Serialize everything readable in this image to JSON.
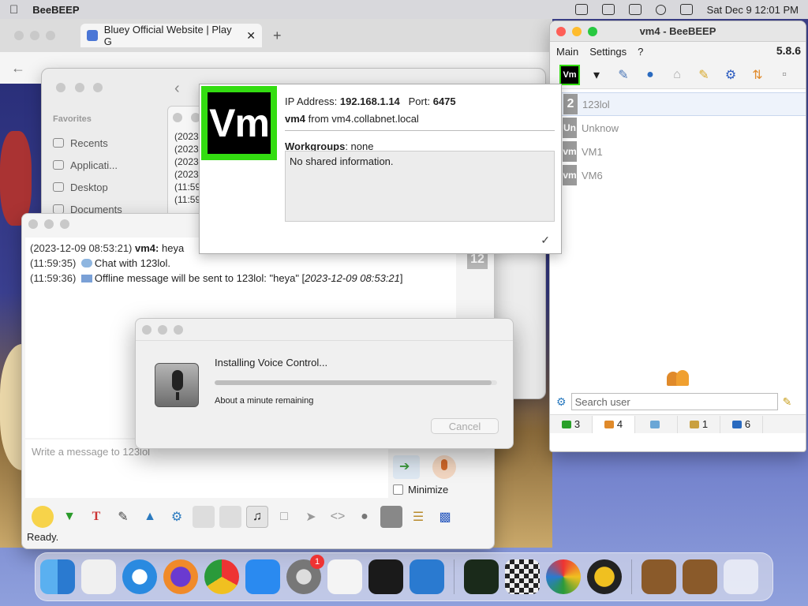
{
  "menubar": {
    "app_name": "BeeBEEP",
    "datetime": "Sat Dec 9  12:01 PM"
  },
  "browser": {
    "tab_title": "Bluey Official Website | Play G",
    "close_symbol": "✕",
    "new_tab_symbol": "+"
  },
  "finder": {
    "section_favorites": "Favorites",
    "items": [
      "Recents",
      "Applicati...",
      "Desktop",
      "Documents"
    ]
  },
  "logwin": {
    "lines": [
      "(2023",
      "(2023",
      "(2023",
      "(2023",
      "(11:59",
      "(11:59"
    ]
  },
  "chat": {
    "title": "123lol",
    "side_number": "12",
    "messages": [
      {
        "ts": "(2023-12-09 08:53:21)",
        "user": "vm4:",
        "text": "heya"
      },
      {
        "ts": "(11:59:35)",
        "text": "Chat with 123lol."
      },
      {
        "ts": "(11:59:36)",
        "text": "Offline message will be sent to 123lol: \"heya\" [",
        "italic": "2023-12-09 08:53:21",
        "end": "]"
      }
    ],
    "input_placeholder": "Write a message to 123lol",
    "minimize_label": "Minimize",
    "status": "Ready."
  },
  "popup": {
    "avatar_text": "Vm",
    "ip_label": "IP Address:",
    "ip_value": "192.168.1.14",
    "port_label": "Port:",
    "port_value": "6475",
    "user": "vm4",
    "from_text": "from vm4.collabnet.local",
    "workgroups_label": "Workgroups",
    "workgroups_value": ": none",
    "shared": "No shared information."
  },
  "voice_control": {
    "title": "Installing Voice Control...",
    "remaining": "About a minute remaining",
    "cancel": "Cancel",
    "progress": 0.98
  },
  "beebeep": {
    "title": "vm4 - BeeBEEP",
    "menu": [
      "Main",
      "Settings",
      "?"
    ],
    "version": "5.8.6",
    "avatar_text": "Vm",
    "users": [
      {
        "badge": "2",
        "name": "123lol"
      },
      {
        "badge": "Un",
        "name": "Unknow"
      },
      {
        "badge": "vm",
        "name": "VM1"
      },
      {
        "badge": "vm",
        "name": "VM6"
      }
    ],
    "search_placeholder": "Search user",
    "tabs": [
      {
        "count": "3"
      },
      {
        "count": "4"
      },
      {
        "count": ""
      },
      {
        "count": "1"
      },
      {
        "count": "6"
      }
    ]
  },
  "dock": {
    "settings_badge": "1"
  }
}
